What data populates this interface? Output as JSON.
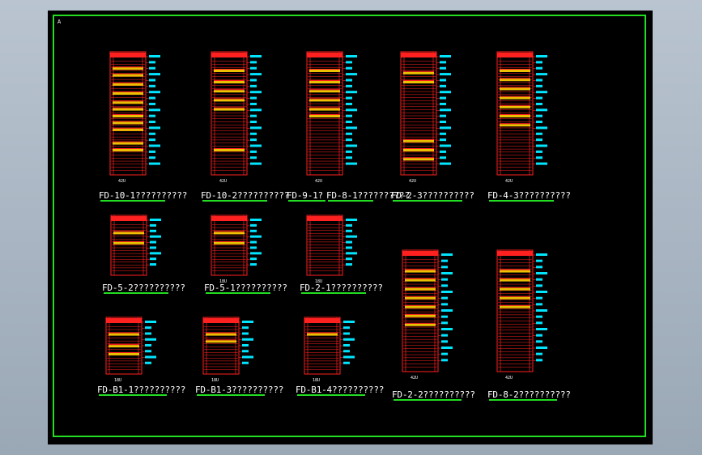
{
  "corner_mark": "A",
  "colors": {
    "frame": "#22dd22",
    "rack": "#ff2020",
    "label": "#00e5ff",
    "text": "#ffffff",
    "fill": "#ffd400",
    "background": "#000000"
  },
  "racks": [
    {
      "title": "FD-10-1??????????",
      "height_label": "42U",
      "slot_fills": [
        0.08,
        0.14,
        0.22,
        0.3,
        0.38,
        0.44,
        0.5,
        0.56,
        0.62,
        0.74,
        0.8
      ]
    },
    {
      "title": "FD-10-2??????????",
      "height_label": "42U",
      "slot_fills": [
        0.1,
        0.2,
        0.28,
        0.36,
        0.44,
        0.8
      ]
    },
    {
      "title": "FD-9-1?",
      "height_label": "42U",
      "slot_fills": [
        0.1,
        0.2,
        0.28,
        0.36,
        0.44,
        0.5
      ]
    },
    {
      "title": "FD-8-1??????????",
      "height_label": "",
      "slot_fills": []
    },
    {
      "title": "FD-2-3??????????",
      "height_label": "42U",
      "slot_fills": [
        0.12,
        0.2,
        0.72,
        0.8,
        0.88
      ]
    },
    {
      "title": "FD-4-3??????????",
      "height_label": "42U",
      "slot_fills": [
        0.1,
        0.18,
        0.26,
        0.34,
        0.42,
        0.5,
        0.58
      ]
    },
    {
      "title": "FD-5-2??????????",
      "height_label": "",
      "slot_fills": [
        0.2,
        0.4
      ]
    },
    {
      "title": "FD-5-1??????????",
      "height_label": "18U",
      "slot_fills": [
        0.2,
        0.4
      ]
    },
    {
      "title": "FD-2-1??????????",
      "height_label": "18U",
      "slot_fills": []
    },
    {
      "title": "FD-B1-1??????????",
      "height_label": "18U",
      "slot_fills": [
        0.2,
        0.45,
        0.62
      ]
    },
    {
      "title": "FD-B1-3??????????",
      "height_label": "18U",
      "slot_fills": [
        0.2,
        0.35
      ]
    },
    {
      "title": "FD-B1-4??????????",
      "height_label": "18U",
      "slot_fills": [
        0.2
      ]
    },
    {
      "title": "FD-2-2??????????",
      "height_label": "42U",
      "slot_fills": [
        0.12,
        0.2,
        0.28,
        0.36,
        0.44,
        0.52,
        0.6
      ]
    },
    {
      "title": "FD-8-2??????????",
      "height_label": "42U",
      "slot_fills": [
        0.12,
        0.2,
        0.28,
        0.36,
        0.44
      ]
    }
  ]
}
